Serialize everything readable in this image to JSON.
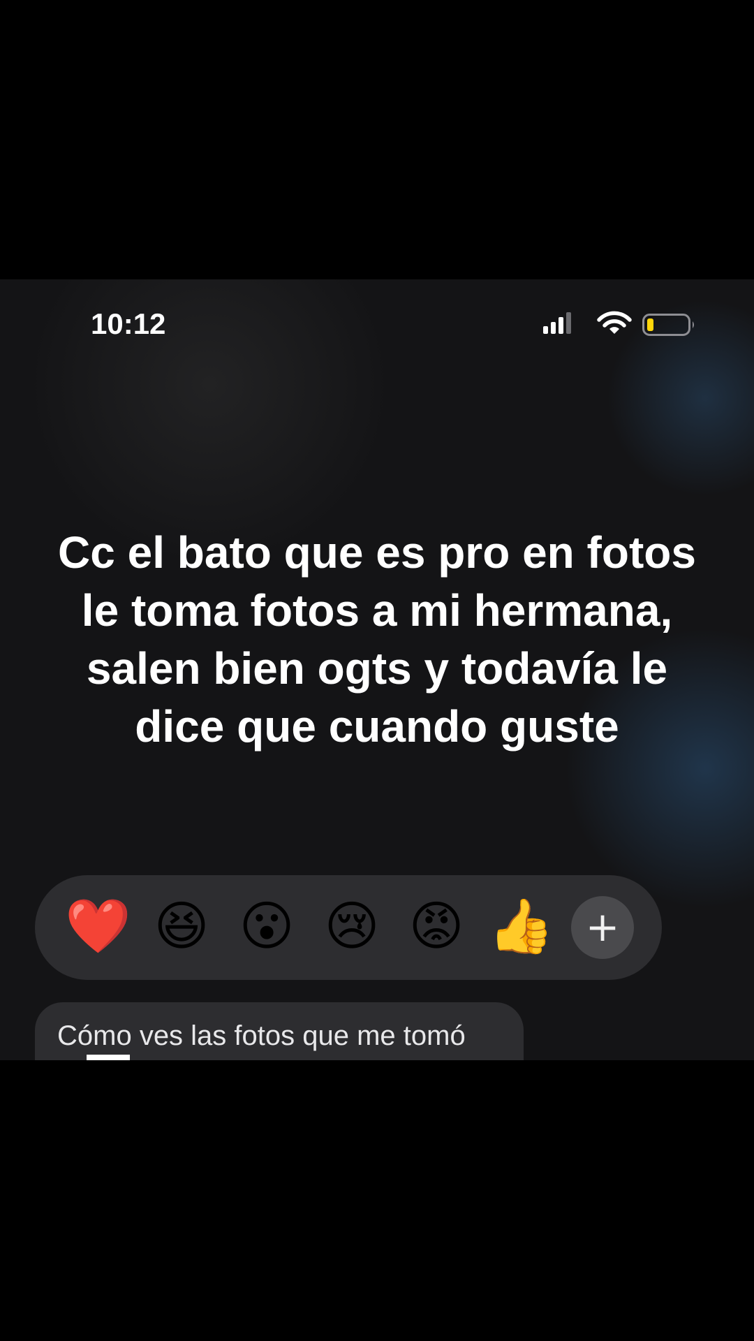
{
  "status_bar": {
    "time": "10:12",
    "signal_icon": "cellular-signal-icon",
    "wifi_icon": "wifi-icon",
    "battery_icon": "battery-low-icon",
    "battery_color": "#ffd60a"
  },
  "caption": {
    "text": "Cc el bato que es pro en fotos le toma fotos a mi hermana, salen bien ogts y todavía le dice que cuando guste"
  },
  "reactions": {
    "heart": "❤️",
    "laugh": "😆",
    "surprised": "😮",
    "crying": "😢",
    "angry": "😡",
    "thumbs_up": "👍",
    "add": "+"
  },
  "message": {
    "text": "Cómo ves las fotos que me tomó"
  }
}
